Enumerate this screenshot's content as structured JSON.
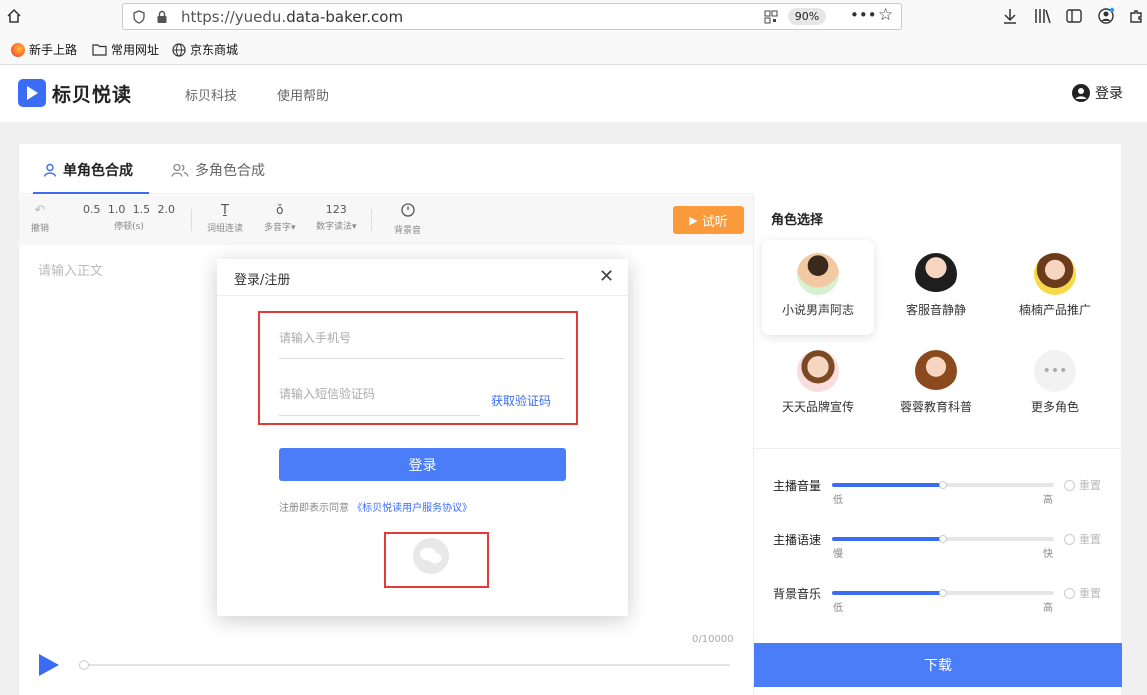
{
  "browser": {
    "url_prefix": "https://yuedu.",
    "url_domain": "data-baker.com",
    "zoom": "90%",
    "bookmarks": [
      "新手上路",
      "常用网址",
      "京东商城"
    ]
  },
  "site": {
    "logo_text": "标贝悦读",
    "nav": [
      "标贝科技",
      "使用帮助"
    ],
    "login_label": "登录"
  },
  "editor": {
    "tabs": [
      "单角色合成",
      "多角色合成"
    ],
    "toolbar": {
      "undo": "撤销",
      "pause_values": [
        "0.5",
        "1.0",
        "1.5",
        "2.0"
      ],
      "pause_label": "停顿(s)",
      "word_link": "词组连读",
      "polyphone": "多音字",
      "number_value": "123",
      "number_read": "数字读法",
      "bg_sound": "背景音"
    },
    "listen_label": "试听",
    "placeholder": "请输入正文",
    "char_count": "0/10000",
    "progress": 0
  },
  "roles": {
    "heading": "角色选择",
    "items": [
      {
        "name": "小说男声阿志",
        "selected": true
      },
      {
        "name": "客服音静静",
        "selected": false
      },
      {
        "name": "楠楠产品推广",
        "selected": false
      },
      {
        "name": "天天品牌宣传",
        "selected": false
      },
      {
        "name": "蓉蓉教育科普",
        "selected": false
      },
      {
        "name": "更多角色",
        "selected": false
      }
    ]
  },
  "sliders": [
    {
      "label": "主播音量",
      "min": "低",
      "max": "高",
      "reset": "重置",
      "level": 0.5
    },
    {
      "label": "主播语速",
      "min": "慢",
      "max": "快",
      "reset": "重置",
      "level": 0.5
    },
    {
      "label": "背景音乐",
      "min": "低",
      "max": "高",
      "reset": "重置",
      "level": 0.5
    }
  ],
  "download_label": "下载",
  "modal": {
    "title": "登录/注册",
    "phone_placeholder": "请输入手机号",
    "code_placeholder": "请输入短信验证码",
    "get_code": "获取验证码",
    "login_button": "登录",
    "agree_prefix": "注册即表示同意",
    "agree_link": "《标贝悦读用户服务协议》"
  },
  "colors": {
    "accent": "#3b6cf5",
    "button": "#4a7df7",
    "listen": "#fa9a3b",
    "highlight": "#e53935"
  }
}
